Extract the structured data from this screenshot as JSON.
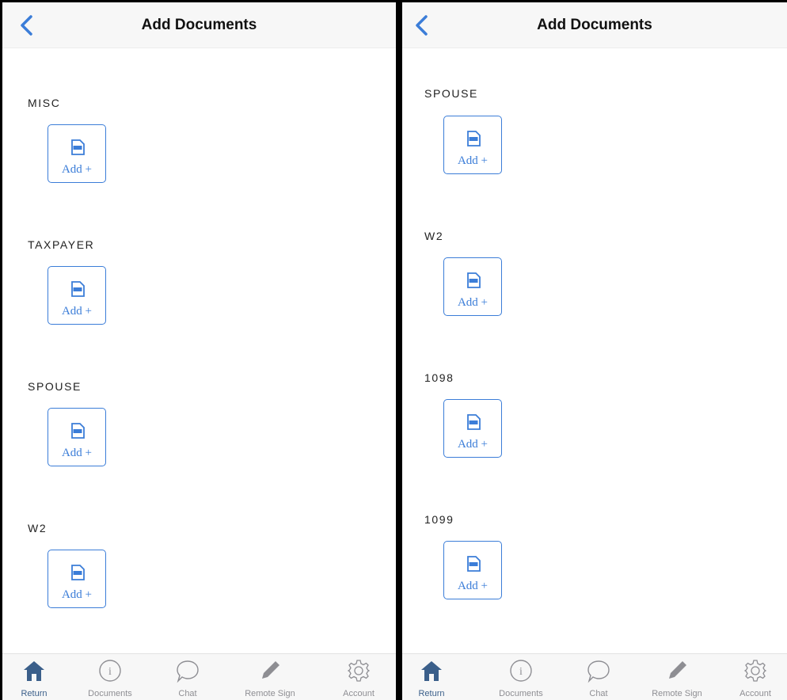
{
  "screens": [
    {
      "header": {
        "title": "Add Documents"
      },
      "sections": [
        {
          "label": "MISC",
          "button_label": "Add +"
        },
        {
          "label": "TAXPAYER",
          "button_label": "Add +"
        },
        {
          "label": "SPOUSE",
          "button_label": "Add +"
        },
        {
          "label": "W2",
          "button_label": "Add +"
        }
      ]
    },
    {
      "header": {
        "title": "Add Documents"
      },
      "sections": [
        {
          "label": "SPOUSE",
          "button_label": "Add +"
        },
        {
          "label": "W2",
          "button_label": "Add +"
        },
        {
          "label": "1098",
          "button_label": "Add +"
        },
        {
          "label": "1099",
          "button_label": "Add +"
        }
      ]
    }
  ],
  "tabs": [
    {
      "label": "Return",
      "icon": "home-icon",
      "active": true
    },
    {
      "label": "Documents",
      "icon": "info-icon",
      "active": false
    },
    {
      "label": "Chat",
      "icon": "chat-bubble-icon",
      "active": false
    },
    {
      "label": "Remote Sign",
      "icon": "pencil-icon",
      "active": false
    },
    {
      "label": "Account",
      "icon": "gear-icon",
      "active": false
    }
  ],
  "colors": {
    "accent": "#3b7dd8",
    "active_tab": "#3b5f8a",
    "inactive_tab": "#8e8e93",
    "header_bg": "#f7f7f7"
  }
}
